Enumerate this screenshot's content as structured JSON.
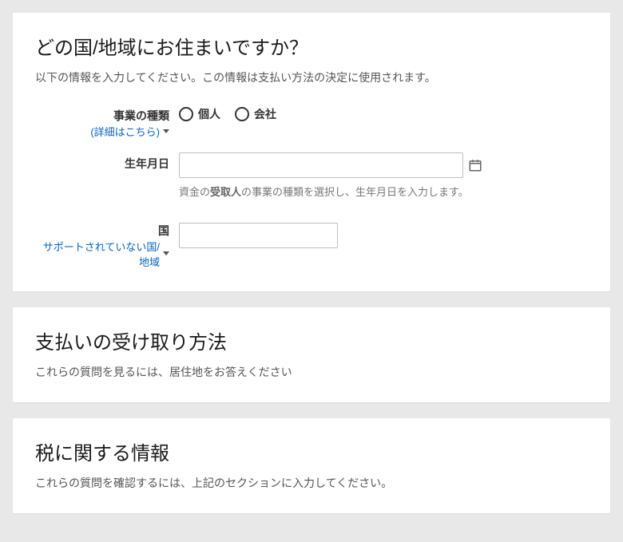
{
  "section1": {
    "title": "どの国/地域にお住まいですか？",
    "desc": "以下の情報を入力してください。この情報は支払い方法の決定に使用されます。",
    "business_type": {
      "label": "事業の種類",
      "sublabel": "(詳細はこちら)",
      "options": {
        "individual": "個人",
        "company": "会社"
      }
    },
    "birthdate": {
      "label": "生年月日",
      "help_prefix": "資金の",
      "help_bold": "受取人",
      "help_suffix": "の事業の種類を選択し、生年月日を入力します。"
    },
    "country": {
      "label": "国",
      "sublabel": "サポートされていない国/地域"
    }
  },
  "section2": {
    "title": "支払いの受け取り方法",
    "desc": "これらの質問を見るには、居住地をお答えください"
  },
  "section3": {
    "title": "税に関する情報",
    "desc": "これらの質問を確認するには、上記のセクションに入力してください。"
  }
}
